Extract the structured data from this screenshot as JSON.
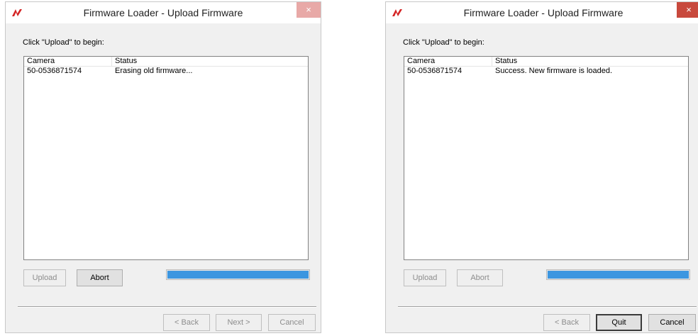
{
  "windows": [
    {
      "title": "Firmware Loader - Upload Firmware",
      "close_symbol": "×",
      "instruction": "Click \"Upload\" to begin:",
      "columns": {
        "camera": "Camera",
        "status": "Status"
      },
      "rows": [
        {
          "camera": "50-0536871574",
          "status": "Erasing old firmware..."
        }
      ],
      "buttons": {
        "upload": "Upload",
        "abort": "Abort",
        "back": "< Back",
        "next": "Next >",
        "cancel": "Cancel"
      },
      "progress": 1.0
    },
    {
      "title": "Firmware Loader - Upload Firmware",
      "close_symbol": "×",
      "instruction": "Click \"Upload\" to begin:",
      "columns": {
        "camera": "Camera",
        "status": "Status"
      },
      "rows": [
        {
          "camera": "50-0536871574",
          "status": "Success.  New firmware is loaded."
        }
      ],
      "buttons": {
        "upload": "Upload",
        "abort": "Abort",
        "back": "< Back",
        "quit": "Quit",
        "cancel": "Cancel"
      },
      "progress": 1.0
    }
  ],
  "colors": {
    "accent": "#3c96e0",
    "logo": "#d42323",
    "close_active": "#c8493d",
    "close_inactive": "#e8a9a7"
  },
  "icons": {
    "logo": "app-logo-icon",
    "close": "close-icon"
  }
}
